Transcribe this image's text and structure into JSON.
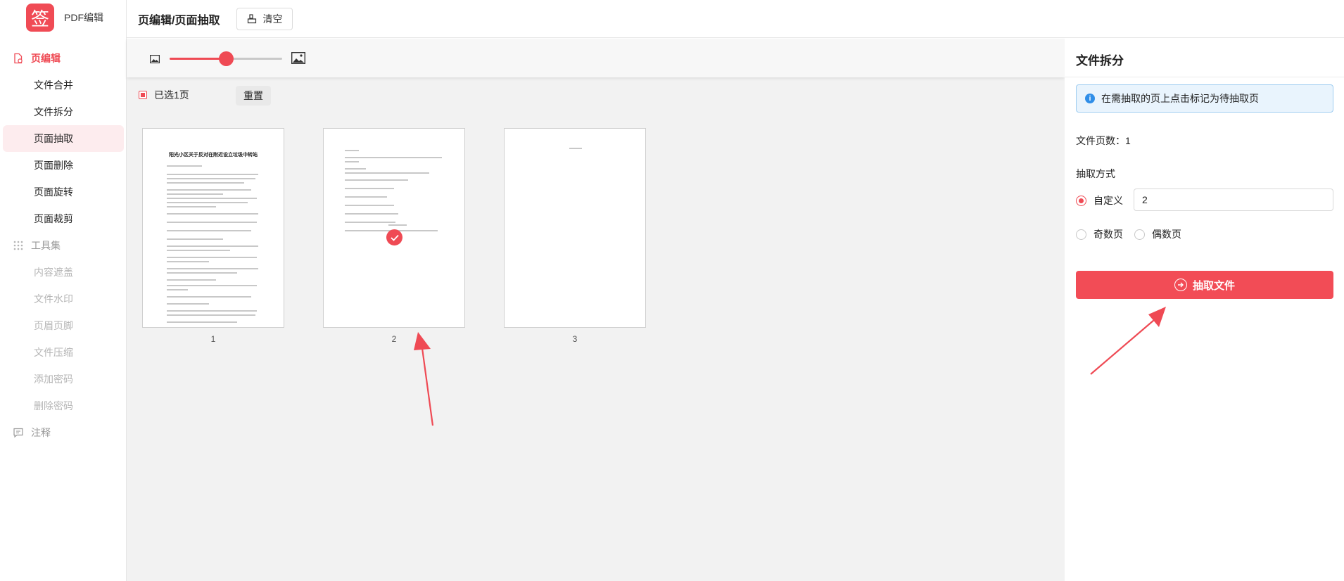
{
  "app": {
    "logo_char": "签",
    "name": "PDF编辑"
  },
  "sidebar": {
    "group_page_edit": "页编辑",
    "items": [
      "文件合并",
      "文件拆分",
      "页面抽取",
      "页面删除",
      "页面旋转",
      "页面裁剪"
    ],
    "group_tools": "工具集",
    "tool_items": [
      "内容遮盖",
      "文件水印",
      "页眉页脚",
      "文件压缩",
      "添加密码",
      "删除密码"
    ],
    "group_notes": "注释"
  },
  "header": {
    "title": "页编辑/页面抽取",
    "clear_label": "清空"
  },
  "toolbar": {
    "zoom_level": 0.5
  },
  "selection": {
    "selected_text": "已选1页",
    "reset_label": "重置"
  },
  "pages": [
    {
      "number": "1",
      "title": "阳光小区关于反对在附近设立垃圾中转站",
      "selected": false
    },
    {
      "number": "2",
      "selected": true
    },
    {
      "number": "3",
      "selected": false
    }
  ],
  "panel": {
    "title": "文件拆分",
    "info": "在需抽取的页上点击标记为待抽取页",
    "page_count": "文件页数：1",
    "method_label": "抽取方式",
    "custom_label": "自定义",
    "custom_value": "2",
    "odd_label": "奇数页",
    "even_label": "偶数页",
    "extract_label": "抽取文件"
  },
  "colors": {
    "accent": "#ef4a54",
    "info_blue": "#2f8ee8"
  }
}
